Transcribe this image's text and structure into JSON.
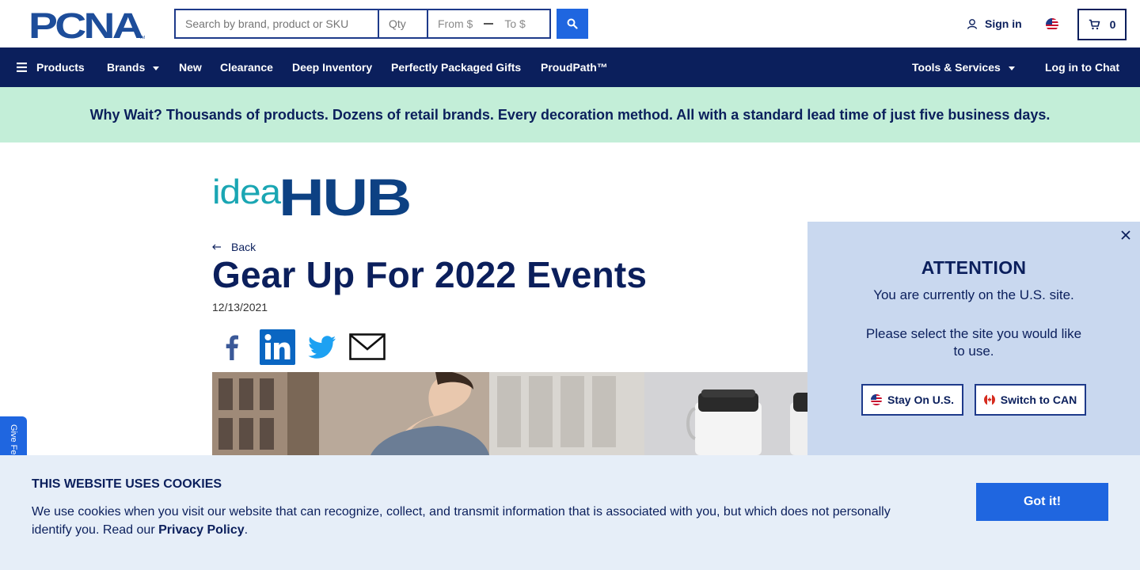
{
  "header": {
    "logo_text": "PCNA",
    "search": {
      "placeholder": "Search by brand, product or SKU"
    },
    "qty": {
      "placeholder": "Qty"
    },
    "price": {
      "from_placeholder": "From $",
      "to_placeholder": "To $"
    },
    "sign_in_label": "Sign in",
    "cart_count": "0"
  },
  "nav": {
    "items": [
      {
        "label": "Products"
      },
      {
        "label": "Brands"
      },
      {
        "label": "New"
      },
      {
        "label": "Clearance"
      },
      {
        "label": "Deep Inventory"
      },
      {
        "label": "Perfectly Packaged Gifts"
      },
      {
        "label": "ProudPath™"
      }
    ],
    "tools_label": "Tools & Services",
    "chat_label": "Log in to Chat"
  },
  "banner": {
    "text": "Why Wait? Thousands of products. Dozens of retail brands. Every decoration method. All with a standard lead time of just five business days."
  },
  "article": {
    "brand_idea": "idea",
    "brand_hub": "HUB",
    "back_label": "Back",
    "title": "Gear Up For 2022 Events",
    "date": "12/13/2021"
  },
  "feedback": {
    "label": "Give Feedback"
  },
  "popup": {
    "title": "ATTENTION",
    "line1": "You are currently on the U.S. site.",
    "line2": "Please select the site you would like to use.",
    "stay_label": "Stay On U.S.",
    "switch_label": "Switch to CAN"
  },
  "cookie": {
    "title": "THIS WEBSITE USES COOKIES",
    "text": "We use cookies when you visit our website that can recognize, collect, and transmit information that is associated with you, but which does not personally identify you. Read our",
    "link_label": "Privacy Policy",
    "suffix": ".",
    "button_label": "Got it!"
  },
  "colors": {
    "navy": "#0b1f5c",
    "accent_blue": "#1f66e0",
    "banner_green": "#c3eed8",
    "popup_bg": "#c9d8ef",
    "cookie_bg": "#e6eef8",
    "idea_teal": "#1aa6b3"
  }
}
